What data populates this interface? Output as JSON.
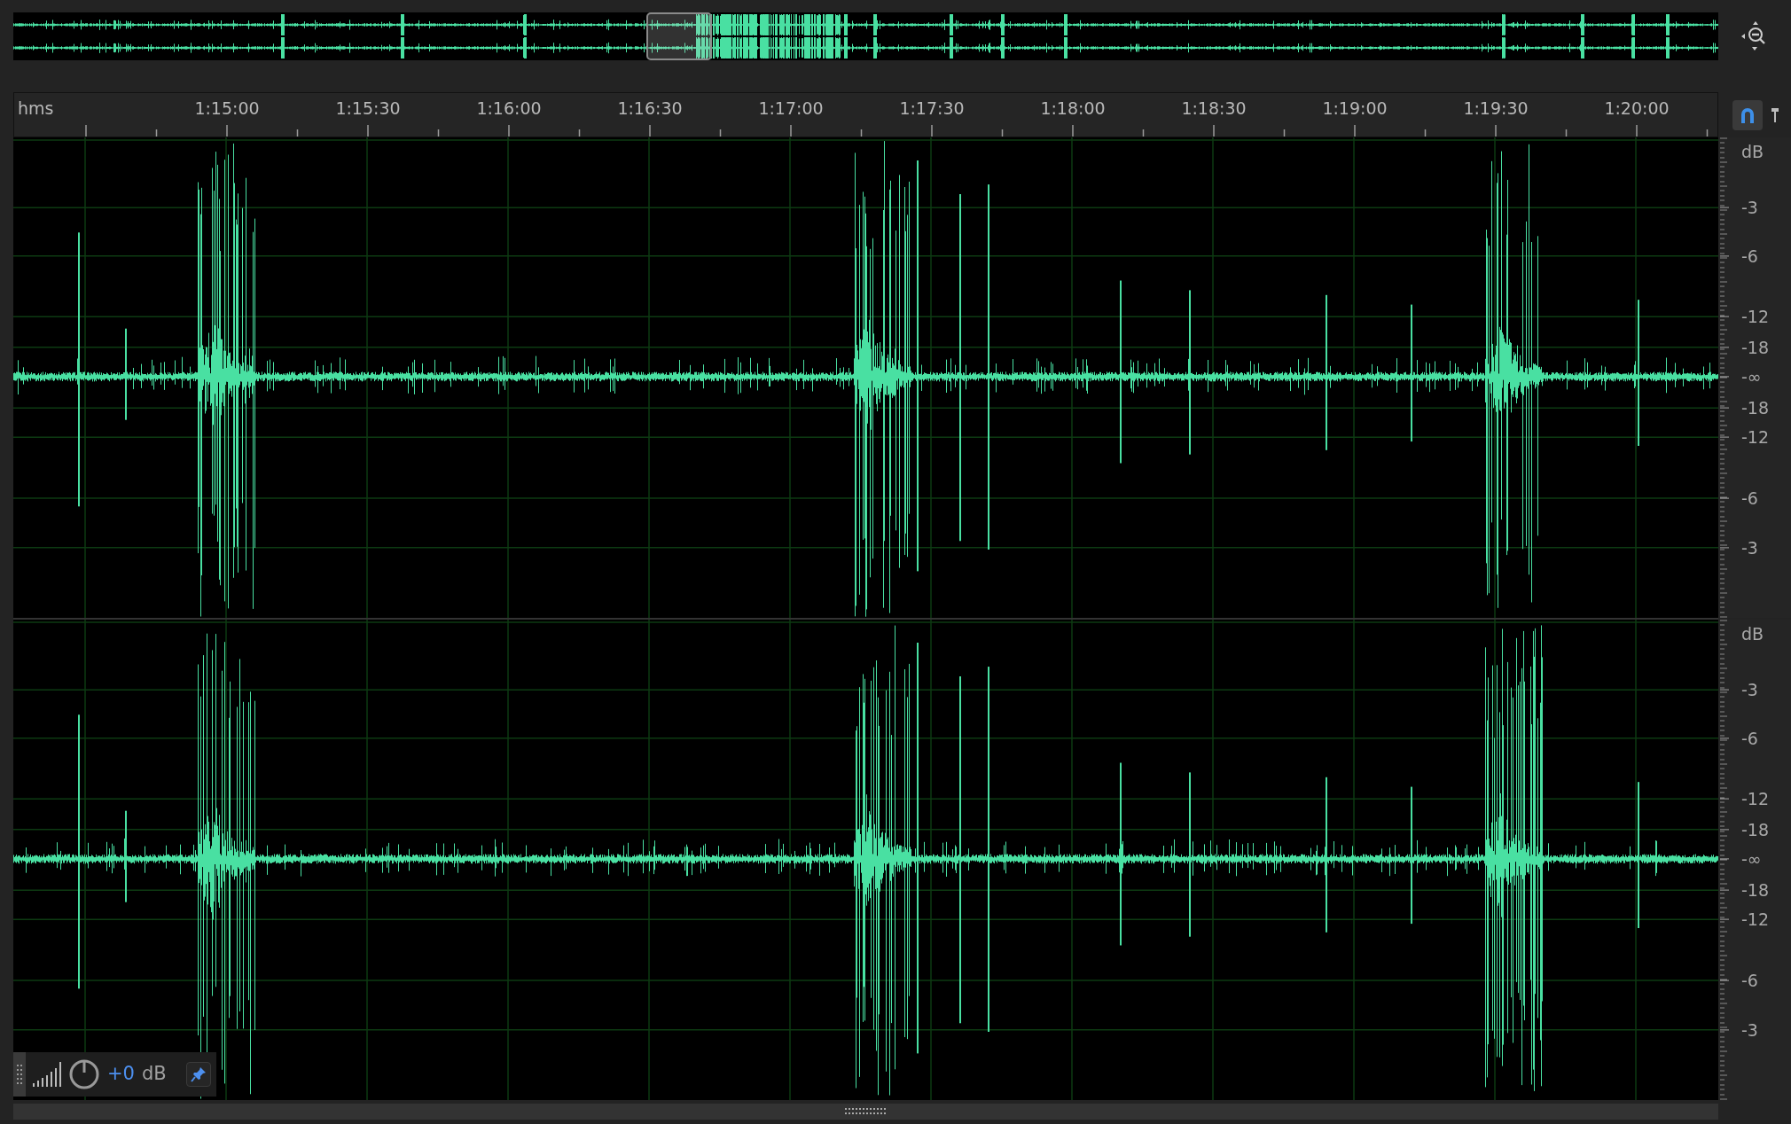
{
  "ruler": {
    "unit": "hms",
    "labels": [
      "1:15:00",
      "1:15:30",
      "1:16:00",
      "1:16:30",
      "1:17:00",
      "1:17:30",
      "1:18:00",
      "1:18:30",
      "1:19:00",
      "1:19:30",
      "1:20:00"
    ]
  },
  "channels": [
    {
      "scale_unit": "dB",
      "scale_labels": [
        "-3",
        "-6",
        "-12",
        "-18",
        "-∞",
        "-18",
        "-12",
        "-6",
        "-3"
      ]
    },
    {
      "scale_unit": "dB",
      "scale_labels": [
        "-3",
        "-6",
        "-12",
        "-18",
        "-∞",
        "-18",
        "-12",
        "-6",
        "-3"
      ]
    }
  ],
  "hud": {
    "gain_value": "+0",
    "gain_unit": "dB"
  }
}
